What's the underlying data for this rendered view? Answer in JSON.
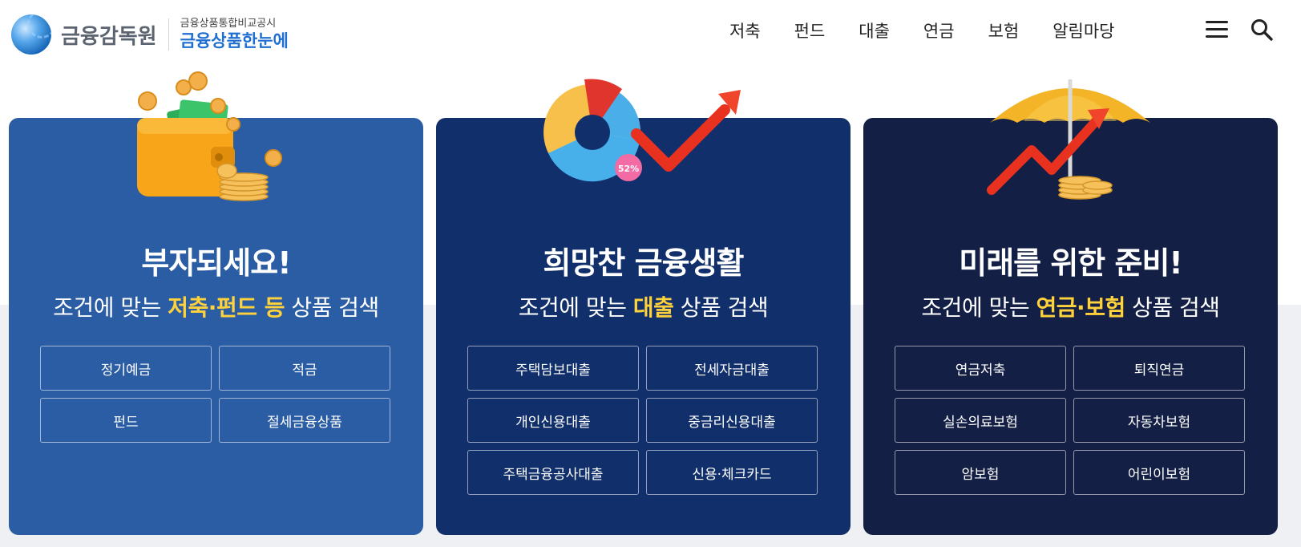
{
  "header": {
    "org_name": "금융감독원",
    "sub_small": "금융상품통합비교공시",
    "sub_big": "금융상품한눈에",
    "nav": [
      "저축",
      "펀드",
      "대출",
      "연금",
      "보험",
      "알림마당"
    ]
  },
  "cards": [
    {
      "title": "부자되세요!",
      "sub_before": "조건에 맞는",
      "sub_highlight": "저축·펀드 등",
      "sub_after": "상품 검색",
      "buttons": [
        "정기예금",
        "적금",
        "펀드",
        "절세금융상품"
      ]
    },
    {
      "title": "희망찬 금융생활",
      "sub_before": "조건에 맞는",
      "sub_highlight": "대출",
      "sub_after": "상품 검색",
      "badge": "52%",
      "buttons": [
        "주택담보대출",
        "전세자금대출",
        "개인신용대출",
        "중금리신용대출",
        "주택금융공사대출",
        "신용·체크카드"
      ]
    },
    {
      "title": "미래를 위한 준비!",
      "sub_before": "조건에 맞는",
      "sub_highlight": "연금·보험",
      "sub_after": "상품 검색",
      "buttons": [
        "연금저축",
        "퇴직연금",
        "실손의료보험",
        "자동차보험",
        "암보험",
        "어린이보험"
      ]
    }
  ],
  "colors": {
    "card1_bg": "#2b5da5",
    "card2_bg": "#102f6b",
    "card3_bg": "#131f45",
    "highlight": "#ffd23c",
    "brand_blue": "#1f6fd1"
  },
  "icons": {
    "menu": "hamburger-menu-icon",
    "search": "search-icon"
  }
}
